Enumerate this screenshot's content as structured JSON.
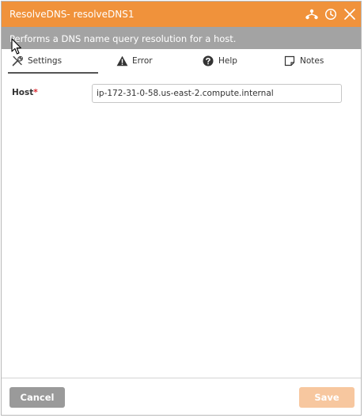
{
  "dialog": {
    "title": "ResolveDNS-  resolveDNS1",
    "description": "Performs a DNS name query resolution for a host.",
    "header_icons": [
      "hierarchy-icon",
      "clock-icon",
      "close-icon"
    ]
  },
  "tabs": [
    {
      "label": "Settings",
      "icon": "wrench-icon",
      "active": true
    },
    {
      "label": "Error",
      "icon": "warning-icon",
      "active": false
    },
    {
      "label": "Help",
      "icon": "help-icon",
      "active": false
    },
    {
      "label": "Notes",
      "icon": "notes-icon",
      "active": false
    }
  ],
  "form": {
    "host": {
      "label": "Host",
      "required_marker": "*",
      "value": "ip-172-31-0-58.us-east-2.compute.internal"
    }
  },
  "footer": {
    "cancel_label": "Cancel",
    "save_label": "Save"
  },
  "colors": {
    "title_bar": "#f0923b",
    "description_bar": "#a3a3a3",
    "cancel_button": "#9a9a9a",
    "save_button_disabled": "#f7c79f",
    "required_marker": "#d9272e"
  }
}
